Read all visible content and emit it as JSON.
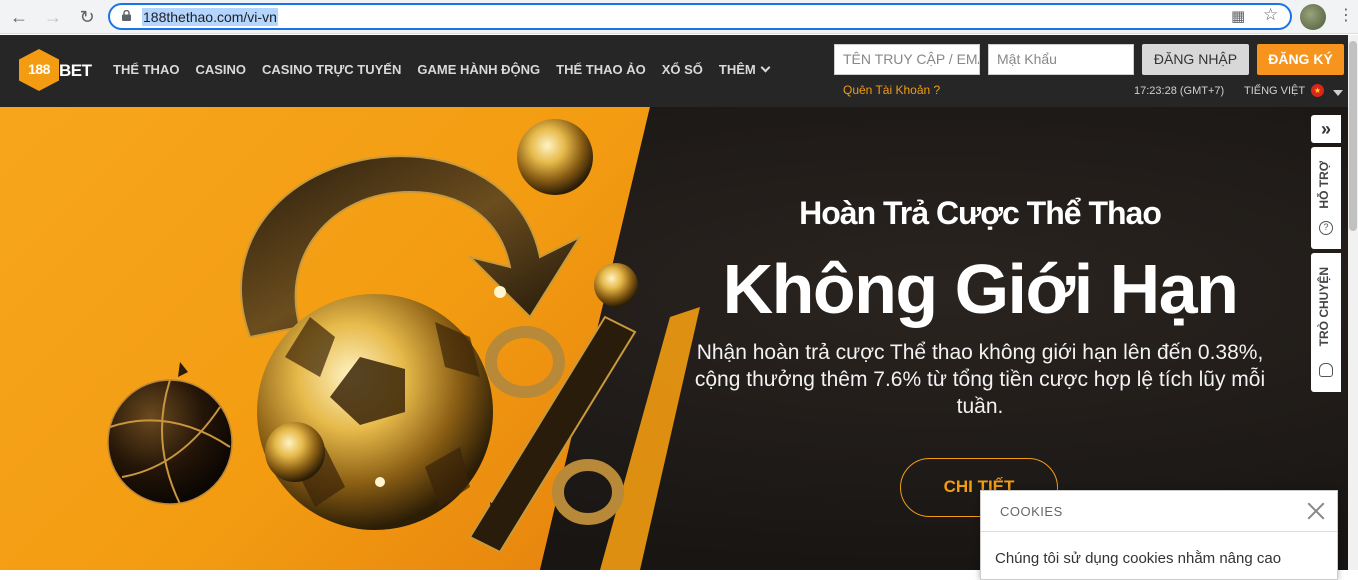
{
  "browser": {
    "url": "188thethao.com/vi-vn",
    "back_icon": "arrow-left-icon",
    "forward_icon": "arrow-right-icon",
    "reload_icon": "reload-icon"
  },
  "header": {
    "logo_number": "188",
    "logo_text": "BET",
    "nav": [
      "THỂ THAO",
      "CASINO",
      "CASINO TRỰC TUYẾN",
      "GAME HÀNH ĐỘNG",
      "THỂ THAO ẢO",
      "XỔ SỐ",
      "THÊM"
    ],
    "username_placeholder": "TÊN TRUY CẬP / EMAIL",
    "password_placeholder": "Mật Khẩu",
    "login_label": "ĐĂNG NHẬP",
    "register_label": "ĐĂNG KÝ",
    "forgot_label": "Quên Tài Khoản ?",
    "clock": "17:23:28 (GMT+7)",
    "language": "TIẾNG VIỆT"
  },
  "hero": {
    "subtitle": "Hoàn Trả Cược Thể Thao",
    "title": "Không Giới Hạn",
    "description": "Nhận hoàn trả cược Thể thao không giới hạn lên đến 0.38%, cộng thưởng thêm 7.6% từ tổng tiền cược hợp lệ tích lũy mỗi tuần.",
    "button_label": "CHI TIẾT"
  },
  "side": {
    "toggle": "»",
    "support_label": "HỖ TRỢ",
    "chat_label": "TRÒ CHUYỆN"
  },
  "cookie": {
    "title": "COOKIES",
    "body": "Chúng tôi sử dụng cookies nhằm nâng cao"
  },
  "colors": {
    "brand_orange": "#f39c12",
    "header_bg": "#262626"
  }
}
